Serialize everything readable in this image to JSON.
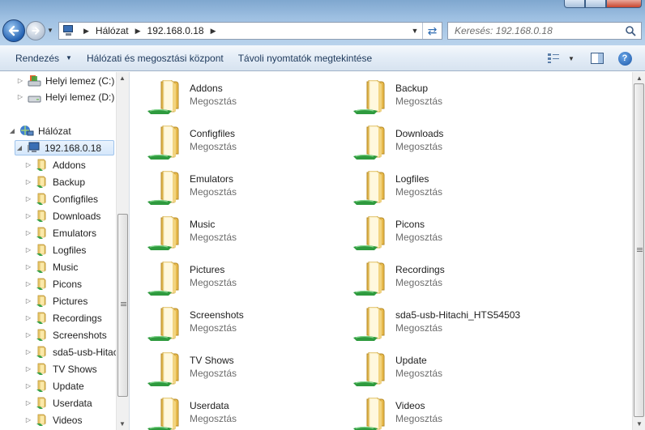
{
  "address": {
    "breadcrumb": [
      "Hálózat",
      "192.168.0.18"
    ],
    "search_placeholder": "Keresés: 192.168.0.18"
  },
  "toolbar": {
    "organize": "Rendezés",
    "network_center": "Hálózati és megosztási központ",
    "remote_printers": "Távoli nyomtatók megtekintése"
  },
  "nav": {
    "drive_c": "Helyi lemez (C:)",
    "drive_d": "Helyi lemez (D:)",
    "network": "Hálózat",
    "host": "192.168.0.18",
    "shares": [
      "Addons",
      "Backup",
      "Configfiles",
      "Downloads",
      "Emulators",
      "Logfiles",
      "Music",
      "Picons",
      "Pictures",
      "Recordings",
      "Screenshots",
      "sda5-usb-Hitac",
      "TV Shows",
      "Update",
      "Userdata",
      "Videos"
    ]
  },
  "content": {
    "items": [
      {
        "name": "Addons",
        "type": "Megosztás"
      },
      {
        "name": "Backup",
        "type": "Megosztás"
      },
      {
        "name": "Configfiles",
        "type": "Megosztás"
      },
      {
        "name": "Downloads",
        "type": "Megosztás"
      },
      {
        "name": "Emulators",
        "type": "Megosztás"
      },
      {
        "name": "Logfiles",
        "type": "Megosztás"
      },
      {
        "name": "Music",
        "type": "Megosztás"
      },
      {
        "name": "Picons",
        "type": "Megosztás"
      },
      {
        "name": "Pictures",
        "type": "Megosztás"
      },
      {
        "name": "Recordings",
        "type": "Megosztás"
      },
      {
        "name": "Screenshots",
        "type": "Megosztás"
      },
      {
        "name": "sda5-usb-Hitachi_HTS54503",
        "type": "Megosztás"
      },
      {
        "name": "TV Shows",
        "type": "Megosztás"
      },
      {
        "name": "Update",
        "type": "Megosztás"
      },
      {
        "name": "Userdata",
        "type": "Megosztás"
      },
      {
        "name": "Videos",
        "type": "Megosztás"
      }
    ]
  },
  "icons": {
    "folder": "shared-folder-icon",
    "drive": "hard-drive-icon",
    "network": "network-icon",
    "computer": "computer-icon"
  }
}
